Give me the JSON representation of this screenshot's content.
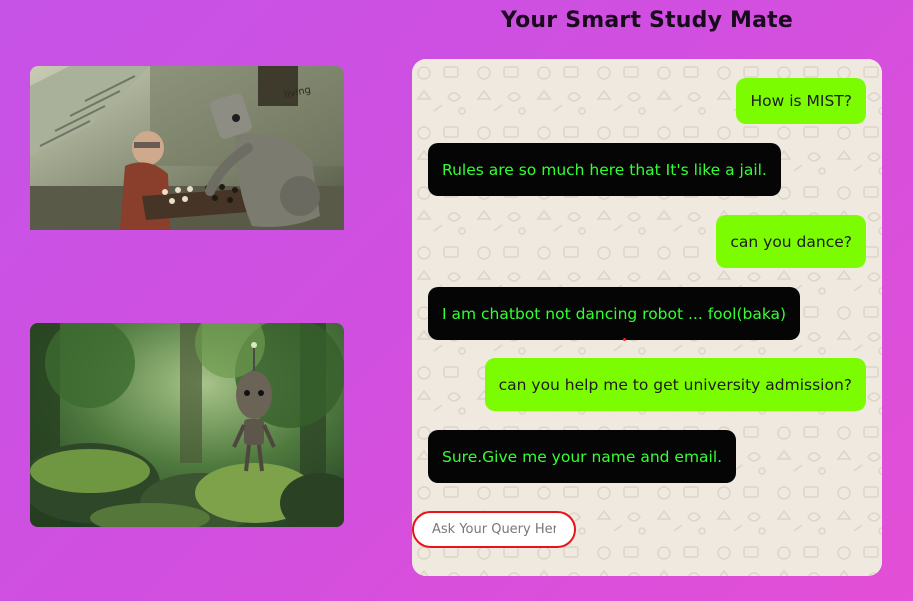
{
  "header": {
    "title": "Your Smart Study Mate"
  },
  "images": [
    {
      "name": "robot-chess-illustration"
    },
    {
      "name": "robot-forest-illustration"
    }
  ],
  "chat": {
    "messages": [
      {
        "from": "user",
        "text": "How is MIST?"
      },
      {
        "from": "bot",
        "text": "Rules are so much here that It's like a jail."
      },
      {
        "from": "user",
        "text": "can you dance?"
      },
      {
        "from": "bot",
        "text": "I am chatbot not dancing robot ... fool(baka)"
      },
      {
        "from": "user",
        "text": "can you help me to get university admission?"
      },
      {
        "from": "bot",
        "text": "Sure.Give me your name and email."
      }
    ],
    "input": {
      "placeholder": "Ask Your Query Here",
      "value": ""
    }
  },
  "colors": {
    "user_bubble": "#7cfc00",
    "bot_bubble": "#050505",
    "bot_text": "#33ff33",
    "input_border": "#e8121b"
  }
}
